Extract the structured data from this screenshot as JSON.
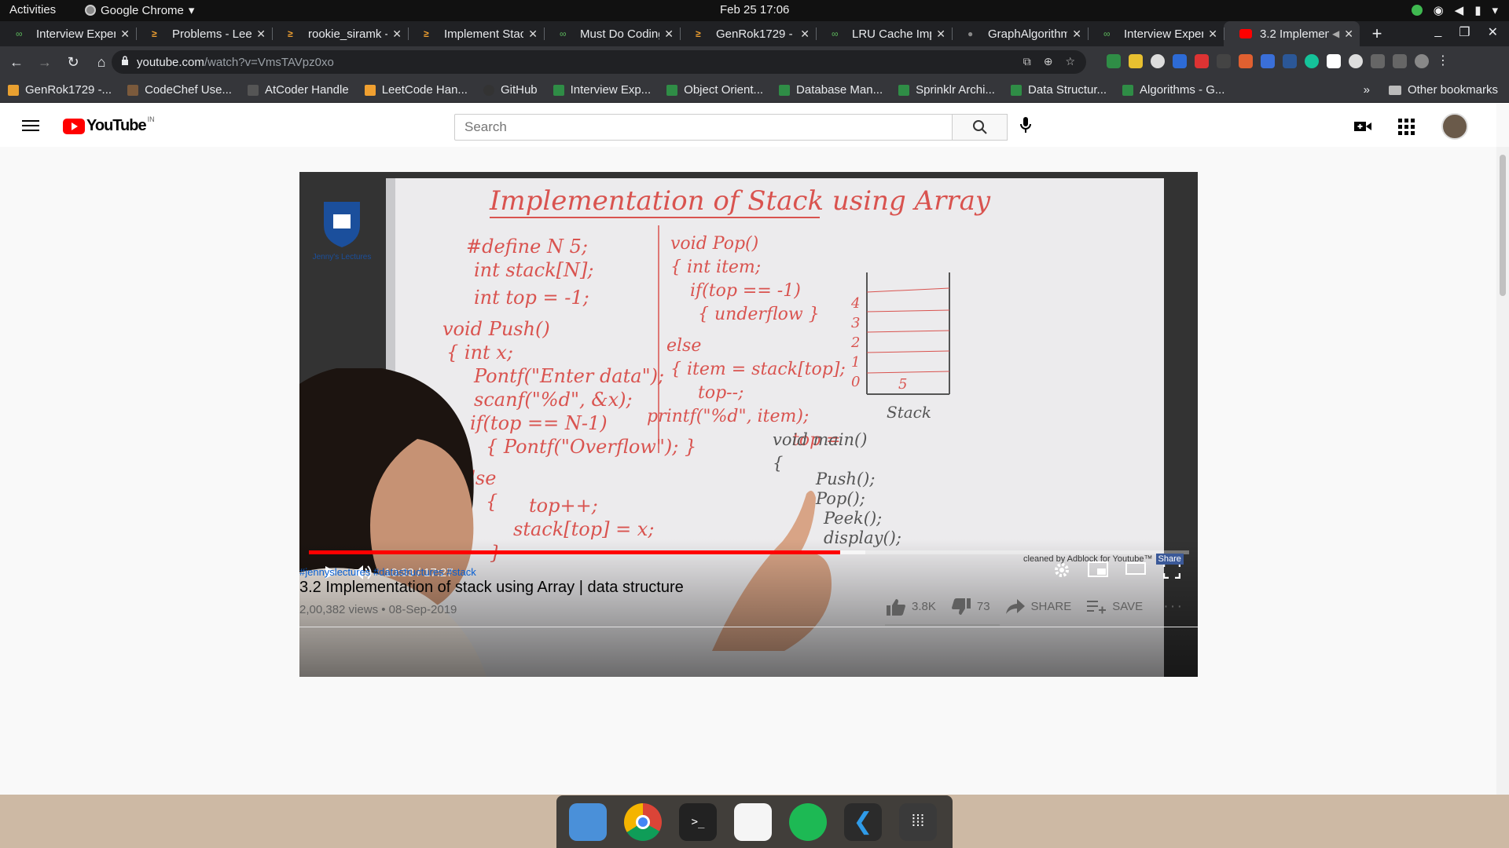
{
  "system": {
    "activities": "Activities",
    "app_name": "Google Chrome",
    "clock": "Feb 25  17:06"
  },
  "tabs": [
    {
      "title": "Interview Exper",
      "icon": "gfg-icon"
    },
    {
      "title": "Problems - Leet",
      "icon": "leetcode-icon"
    },
    {
      "title": "rookie_siramk -",
      "icon": "leetcode-icon"
    },
    {
      "title": "Implement Stac",
      "icon": "leetcode-icon"
    },
    {
      "title": "Must Do Coding",
      "icon": "gfg-icon"
    },
    {
      "title": "GenRok1729 - L",
      "icon": "leetcode-icon"
    },
    {
      "title": "LRU Cache Impl",
      "icon": "gfg-icon"
    },
    {
      "title": "GraphAlgorithm",
      "icon": "github-icon"
    },
    {
      "title": "Interview Exper",
      "icon": "gfg-icon"
    },
    {
      "title": "3.2 Implemen",
      "icon": "youtube-icon",
      "active": true
    }
  ],
  "omnibox": {
    "host": "youtube.com",
    "path": "/watch?v=VmsTAVpz0xo"
  },
  "bookmarks": [
    {
      "label": "GenRok1729 -...",
      "color": "#e8a030"
    },
    {
      "label": "CodeChef Use...",
      "color": "#7b5a3c"
    },
    {
      "label": "AtCoder Handle",
      "color": "#555555"
    },
    {
      "label": "LeetCode Han...",
      "color": "#f0a030"
    },
    {
      "label": "GitHub",
      "color": "#333333"
    },
    {
      "label": "Interview Exp...",
      "color": "#2f8d46"
    },
    {
      "label": "Object Orient...",
      "color": "#2f8d46"
    },
    {
      "label": "Database Man...",
      "color": "#2f8d46"
    },
    {
      "label": "Sprinklr Archi...",
      "color": "#2f8d46"
    },
    {
      "label": "Data Structur...",
      "color": "#2f8d46"
    },
    {
      "label": "Algorithms - G...",
      "color": "#2f8d46"
    }
  ],
  "bookmarks_more": "»",
  "other_bookmarks": "Other bookmarks",
  "youtube": {
    "logo_text": "YouTube",
    "region": "IN",
    "search_placeholder": "Search"
  },
  "player": {
    "time": "10:33 / 17:27",
    "progress_fraction": 0.604,
    "buffered_fraction": 0.632,
    "channel_logo_text": "Jenny's Lectures"
  },
  "board": {
    "title": "Implementation of Stack using Array",
    "left_code": [
      "#define N 5;",
      "int stack[N];",
      "int top = -1;",
      "void Push()",
      "{  int x;",
      "Pontf(\"Enter data\");",
      "scanf(\"%d\", &x);",
      "if(top == N-1)",
      "{  Pontf(\"Overflow\"); }",
      "else",
      "{",
      "top++;",
      "stack[top] = x;",
      "}",
      "}"
    ],
    "right_code": [
      "void Pop()",
      "{  int item;",
      "if(top == -1)",
      "{  underflow }",
      "else",
      "{ item = stack[top];",
      "top--;",
      "printf(\"%d\", item);",
      "top ="
    ],
    "main_code": [
      "void main()",
      "{",
      "Push();",
      "Pop();",
      "Peek();",
      "display();",
      "}"
    ],
    "stack_label": "Stack",
    "stack_indices": [
      "4",
      "3",
      "2",
      "1",
      "0"
    ],
    "stack_value": "5"
  },
  "adblock": {
    "text": "cleaned by Adblock for Youtube™",
    "share": "Share"
  },
  "video": {
    "hashtags": "#jennyslectures #datastructures #stack",
    "title": "3.2 Implementation of stack using Array | data structure",
    "meta": "2,00,382 views • 08-Sep-2019",
    "likes": "3.8K",
    "dislikes": "73",
    "share": "SHARE",
    "save": "SAVE"
  },
  "dock": [
    {
      "name": "finder-icon",
      "color": "#4a90d9"
    },
    {
      "name": "chrome-icon",
      "color": "#dddddd"
    },
    {
      "name": "terminal-icon",
      "color": "#222222"
    },
    {
      "name": "notes-icon",
      "color": "#f5f5f5"
    },
    {
      "name": "spotify-icon",
      "color": "#1db954"
    },
    {
      "name": "vscode-icon",
      "color": "#2b2b2b"
    },
    {
      "name": "app-grid-icon",
      "color": "#3a3a3a"
    }
  ]
}
